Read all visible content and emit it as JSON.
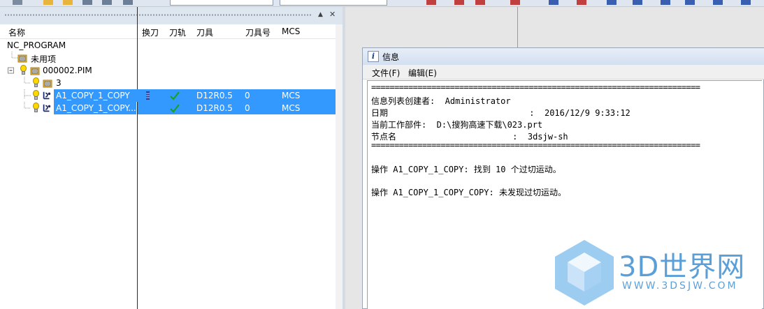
{
  "navigator": {
    "columns": [
      "名称",
      "换刀",
      "刀轨",
      "刀具",
      "刀具号",
      "MCS"
    ],
    "tree": [
      {
        "label": "NC_PROGRAM"
      },
      {
        "label": "未用项"
      },
      {
        "label": "000002.PIM"
      },
      {
        "label": "3"
      },
      {
        "label": "A1_COPY_1_COPY",
        "tool": "D12R0.5",
        "tool_number": "0",
        "mcs": "MCS",
        "selected": true
      },
      {
        "label": "A1_COPY_1_COPY...",
        "tool": "D12R0.5",
        "tool_number": "0",
        "mcs": "MCS",
        "selected": true
      }
    ]
  },
  "info_window": {
    "title": "信息",
    "menu": [
      "文件(F)",
      "编辑(E)"
    ],
    "lines": [
      "=======================================================================",
      "信息列表创建者:  Administrator",
      "日期                            :  2016/12/9 9:33:12",
      "当前工作部件:  D:\\搜狗高速下载\\023.prt",
      "节点名                       :  3dsjw-sh",
      "=======================================================================",
      "",
      "操作 A1_COPY_1_COPY: 找到 10 个过切运动。",
      "",
      "操作 A1_COPY_1_COPY_COPY: 未发现过切运动。"
    ]
  },
  "watermark": {
    "brand": "3D世界网",
    "url": "WWW.3DSJW.COM"
  },
  "colors": {
    "selection": "#3399ff",
    "watermark": "#5b9fd9"
  }
}
